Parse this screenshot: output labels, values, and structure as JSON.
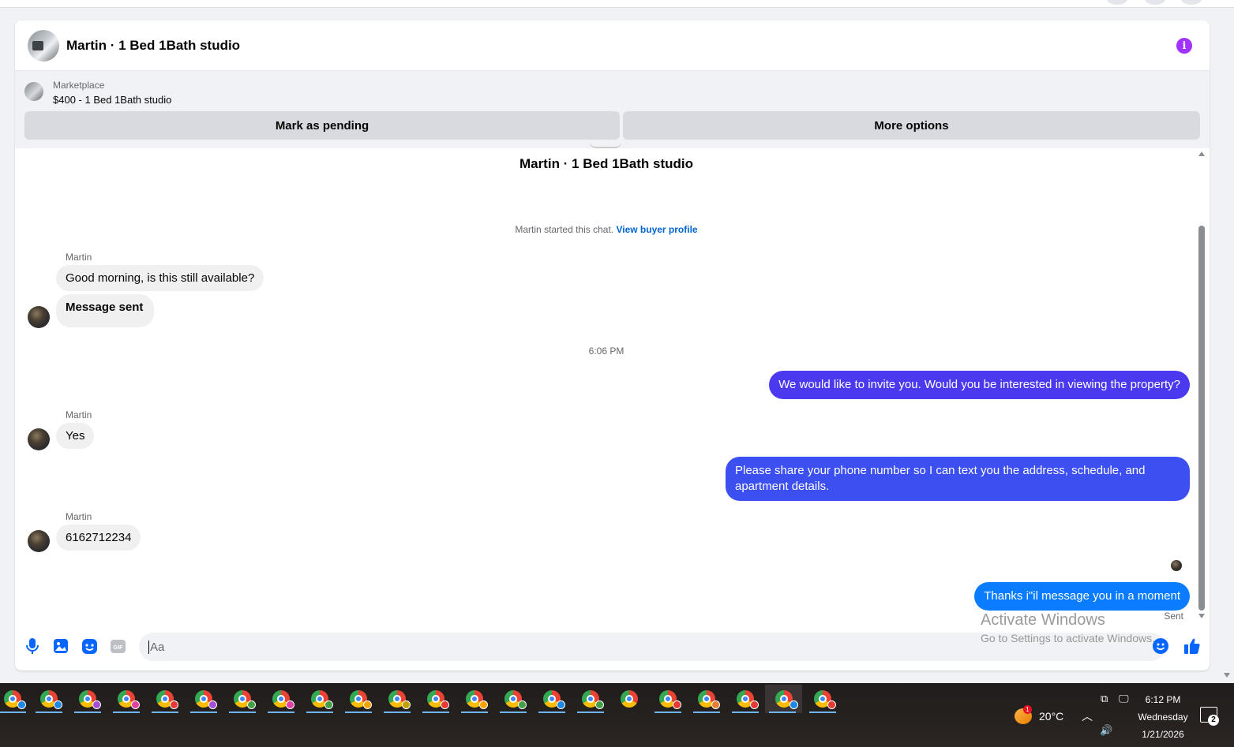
{
  "header": {
    "title": "Martin · 1 Bed 1Bath studio"
  },
  "marketplace": {
    "label": "Marketplace",
    "title": "$400 - 1 Bed 1Bath studio",
    "buttons": {
      "pending": "Mark as pending",
      "more": "More options"
    }
  },
  "conversation": {
    "title": "Martin · 1 Bed 1Bath studio",
    "started_text": "Martin started this chat.",
    "profile_link": "View buyer profile",
    "timestamp": "6:06 PM",
    "messages": [
      {
        "sender": "Martin",
        "text": "Good morning, is this still available?"
      },
      {
        "text": "Message sent"
      },
      {
        "text": "We would like to invite you. Would you be interested in viewing the property?"
      },
      {
        "sender": "Martin",
        "text": "Yes"
      },
      {
        "text": "Please share your phone number so I can text you the address, schedule, and apartment details."
      },
      {
        "sender": "Martin",
        "text": "6162712234"
      },
      {
        "text": "Thanks i\"il message you in a moment"
      }
    ],
    "status": "Sent"
  },
  "composer": {
    "placeholder": "Aa",
    "gif_label": "GIF"
  },
  "watermark": {
    "line1": "Activate Windows",
    "line2": "Go to Settings to activate Windows."
  },
  "taskbar": {
    "weather_temp": "20°C",
    "weather_badge": "1",
    "time": "6:12 PM",
    "day": "Wednesday",
    "date": "1/21/2026",
    "notification_count": "2"
  },
  "colors": {
    "bubble_purple": "#4b39ef",
    "bubble_violet": "#3c4ff0",
    "bubble_blue": "#0a7cff",
    "incoming_bg": "#f0f0f0",
    "link": "#0064d1",
    "info_accent": "#a033ff"
  }
}
